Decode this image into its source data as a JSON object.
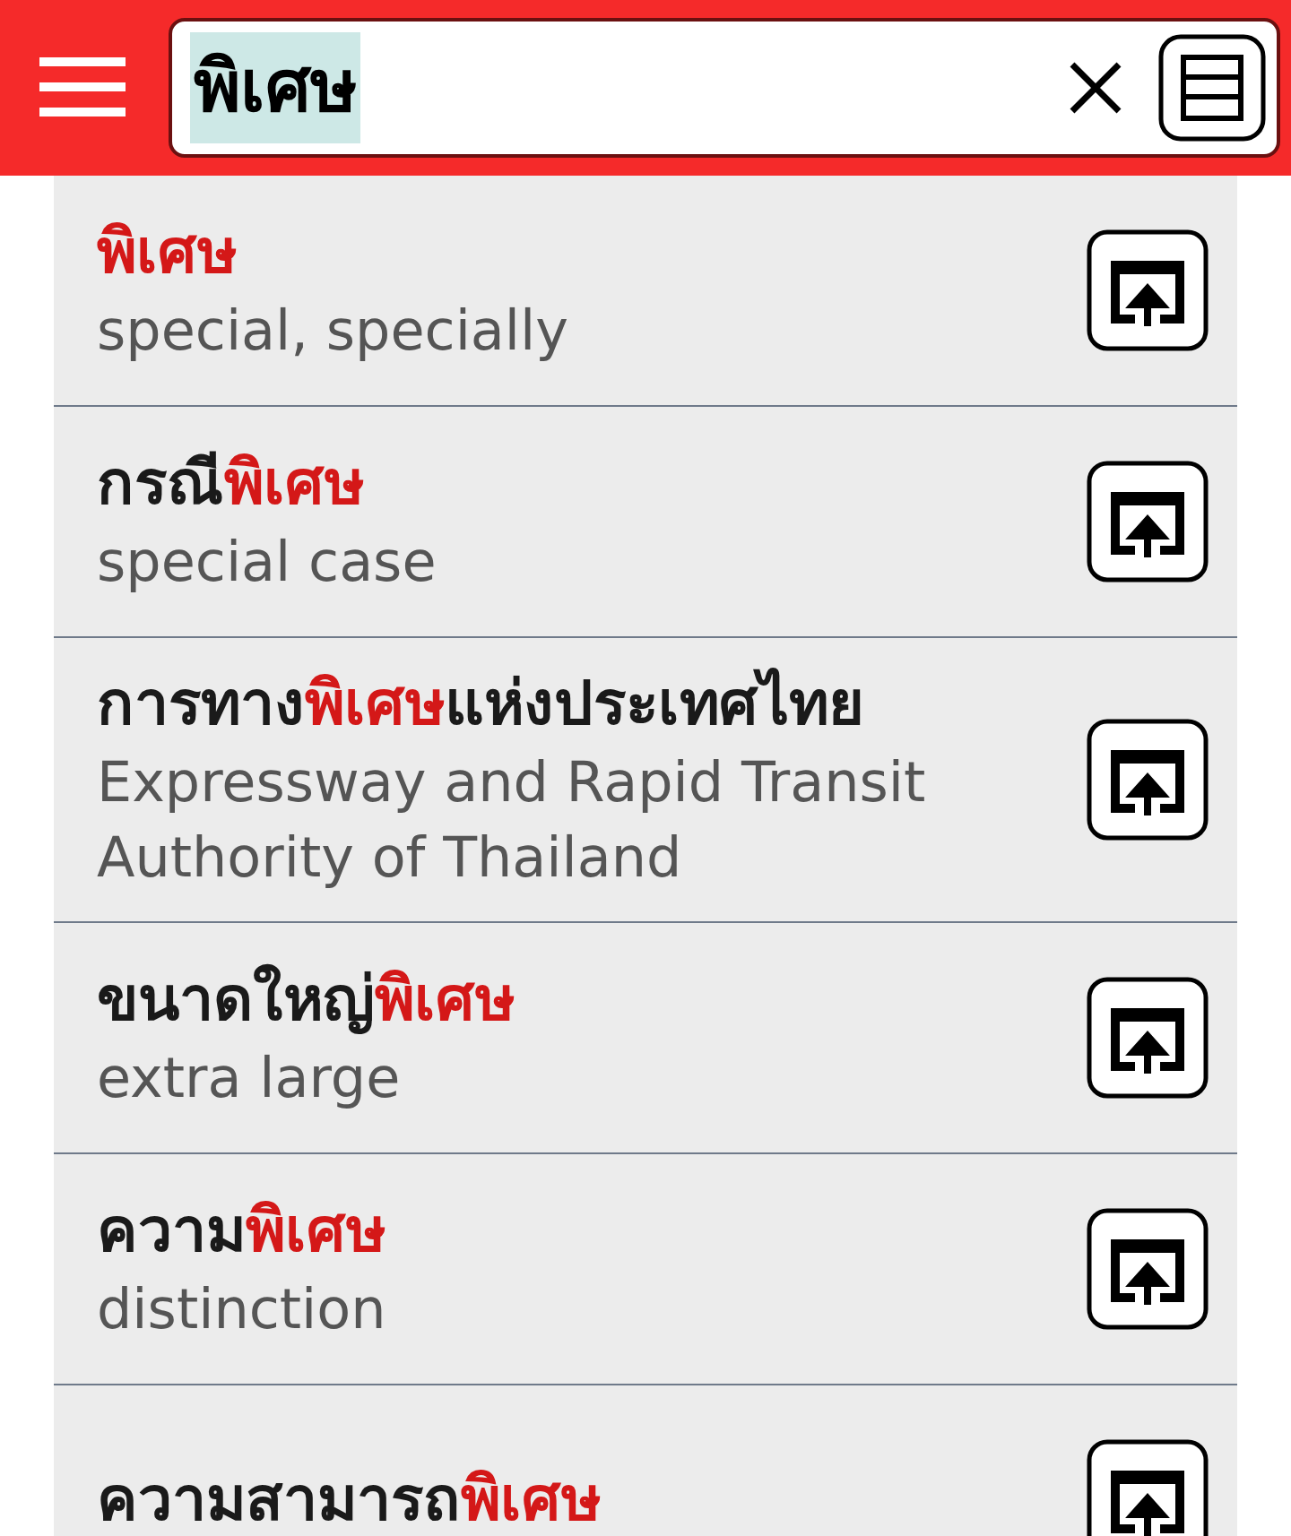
{
  "search": {
    "value": "พิเศษ",
    "value_selected": true
  },
  "results": [
    {
      "headword": [
        {
          "text": "พิเศษ",
          "match": true
        }
      ],
      "meaning": "special, specially"
    },
    {
      "headword": [
        {
          "text": "กรณี",
          "match": false
        },
        {
          "text": "พิเศษ",
          "match": true
        }
      ],
      "meaning": "special case"
    },
    {
      "headword": [
        {
          "text": "การทาง",
          "match": false
        },
        {
          "text": "พิเศษ",
          "match": true
        },
        {
          "text": "แห่งประเทศไทย",
          "match": false
        }
      ],
      "meaning": "Expressway and Rapid Transit Authority of Thailand"
    },
    {
      "headword": [
        {
          "text": "ขนาดใหญ่",
          "match": false
        },
        {
          "text": "พิเศษ",
          "match": true
        }
      ],
      "meaning": "extra large"
    },
    {
      "headword": [
        {
          "text": "ความ",
          "match": false
        },
        {
          "text": "พิเศษ",
          "match": true
        }
      ],
      "meaning": "distinction"
    },
    {
      "headword": [
        {
          "text": "ความสามารถ",
          "match": false
        },
        {
          "text": "พิเศษ",
          "match": true
        }
      ]
    }
  ]
}
